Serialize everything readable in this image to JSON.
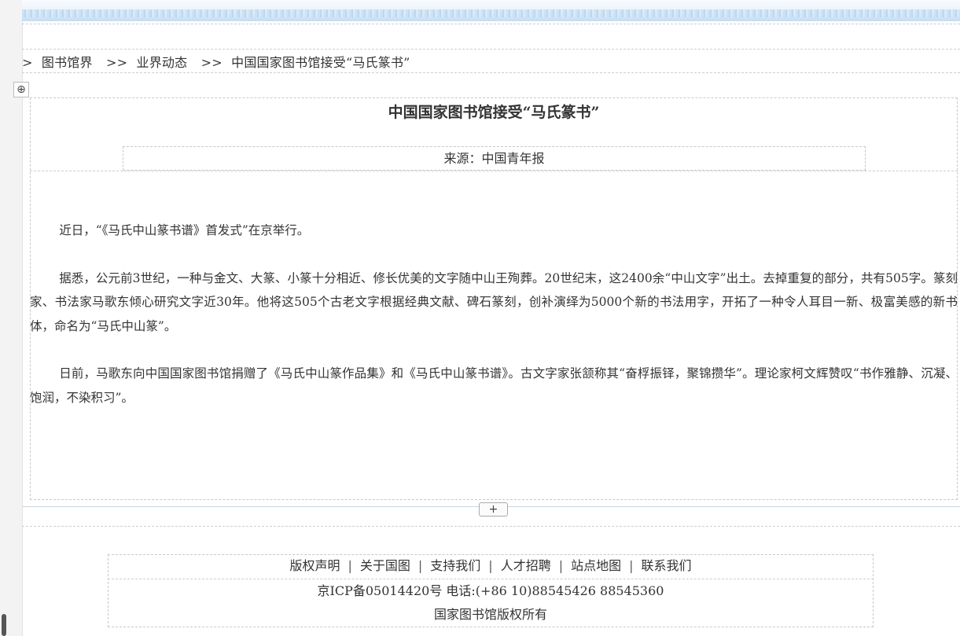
{
  "breadcrumb": {
    "leading": ">",
    "items": [
      "图书馆界",
      "业界动态",
      "中国国家图书馆接受“马氏篆书”"
    ],
    "separator": ">>"
  },
  "icons": {
    "move_handle": "⊕",
    "add_row": "+"
  },
  "article": {
    "title": "中国国家图书馆接受“马氏篆书”",
    "source": "来源：中国青年报",
    "paragraphs": [
      "近日，“《马氏中山篆书谱》首发式”在京举行。",
      "据悉，公元前3世纪，一种与金文、大篆、小篆十分相近、修长优美的文字随中山王殉葬。20世纪末，这2400余“中山文字”出土。去掉重复的部分，共有505字。篆刻家、书法家马歌东倾心研究文字近30年。他将这505个古老文字根据经典文献、碑石篆刻，创补演绎为5000个新的书法用字，开拓了一种令人耳目一新、极富美感的新书体，命名为“马氏中山篆”。",
      "日前，马歌东向中国国家图书馆捐赠了《马氏中山篆作品集》和《马氏中山篆书谱》。古文字家张颔称其“奋桴振铎，聚锦攒华”。理论家柯文辉赞叹“书作雅静、沉凝、饱润，不染积习”。"
    ]
  },
  "footer": {
    "links": [
      "版权声明",
      "关于国图",
      "支持我们",
      "人才招聘",
      "站点地图",
      "联系我们"
    ],
    "icp": "京ICP备05014420号 电话:(+86 10)88545426 88545360",
    "copyright": "国家图书馆版权所有"
  }
}
